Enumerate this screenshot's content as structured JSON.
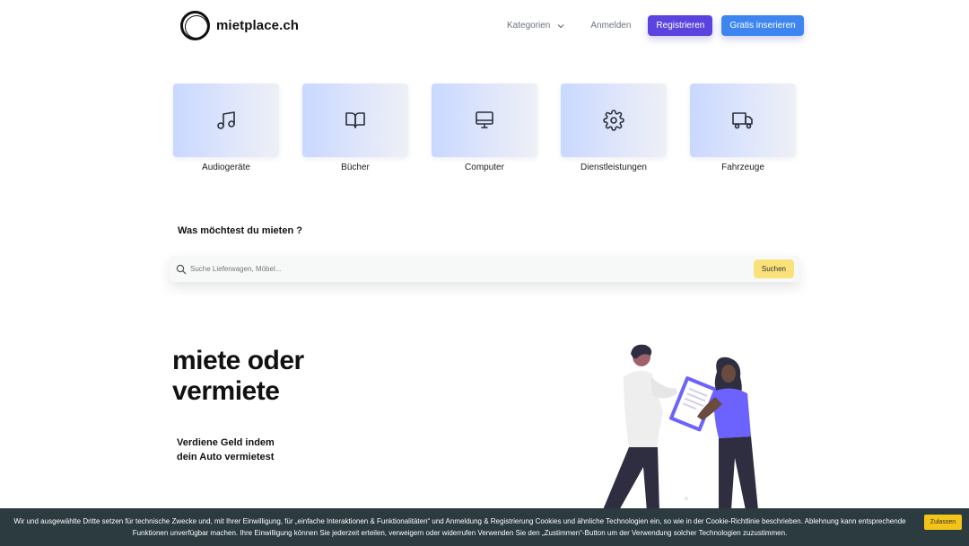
{
  "header": {
    "logo_text": "mietplace.ch",
    "nav": {
      "categories_label": "Kategorien",
      "login_label": "Anmelden",
      "register_label": "Registrieren",
      "insert_label": "Gratis inserieren"
    }
  },
  "categories": [
    {
      "label": "Audiogeräte",
      "icon": "music-note-icon"
    },
    {
      "label": "Bücher",
      "icon": "book-icon"
    },
    {
      "label": "Computer",
      "icon": "monitor-icon"
    },
    {
      "label": "Dienstleistungen",
      "icon": "gear-icon"
    },
    {
      "label": "Fahrzeuge",
      "icon": "truck-icon"
    }
  ],
  "search": {
    "question": "Was möchtest du mieten ?",
    "placeholder": "Suche Lieferwagen, Möbel...",
    "value": "",
    "button_label": "Suchen"
  },
  "hero": {
    "title_line1": "miete oder",
    "title_line2": "vermiete",
    "subtitle": "Verdiene Geld indem dein Auto vermietest"
  },
  "cookie": {
    "text": "Wir und ausgewählte Dritte setzen für technische Zwecke und, mit Ihrer Einwilligung, für „einfache Interaktionen & Funktionalitäten“ und Anmeldung & Registrierung Cookies und ähnliche Technologien ein, so wie in der Cookie-Richtlinie beschrieben. Ablehnung kann entsprechende Funktionen unverfügbar machen. Ihre Einwilligung können Sie jederzeit erteilen, verweigern oder widerrufen Verwenden Sie den „Zustimmen“-Button um der Verwendung solcher Technologien zuzustimmen.",
    "accept_label": "Zulassen"
  },
  "colors": {
    "register_button": "#5b43e0",
    "insert_button": "#3d86f0",
    "search_button": "#fbe17a",
    "cookie_bar": "#2b3b40",
    "cookie_button": "#f2c419",
    "illustration_accent": "#6c63ff"
  }
}
